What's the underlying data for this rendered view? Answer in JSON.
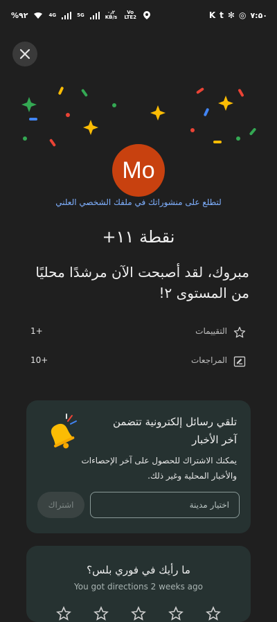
{
  "status_bar": {
    "battery": "%۹۲",
    "net_4g": "4G",
    "net_5g": "5G",
    "speed": "۰٫۲",
    "speed_unit": "KB/s",
    "volte": "Vo LTE2",
    "time": "۷:۵۰"
  },
  "dialog": {
    "close_icon": "close-icon",
    "avatar_initials": "Mo",
    "profile_link": "لتطلع على منشوراتك في ملفك الشخصي العلني",
    "points": "+۱۱ نقطة",
    "congrats": "مبروك، لقد أصبحت الآن مرشدًا محليًا من المستوى ۲!"
  },
  "stats": [
    {
      "icon": "star-outline-icon",
      "label": "التقييمات",
      "value": "1+"
    },
    {
      "icon": "review-edit-icon",
      "label": "المراجعات",
      "value": "10+"
    }
  ],
  "newsletter": {
    "title": "تلقي رسائل إلكترونية تتضمن آخر الأخبار",
    "description": "يمكنك الاشتراك للحصول على آخر الإحصاءات والأخبار المحلية وغير ذلك.",
    "city_placeholder": "اختيار مدينة",
    "subscribe_label": "اشتراك",
    "bell_icon": "bell-icon"
  },
  "rating_prompt": {
    "question": "ما رأيك في فوري بلس؟",
    "subtitle": "You got directions 2 weeks ago",
    "stars": 5
  },
  "colors": {
    "background": "#1f1f1f",
    "card": "#263231",
    "avatar": "#c8410f",
    "link": "#7fb0ff"
  }
}
